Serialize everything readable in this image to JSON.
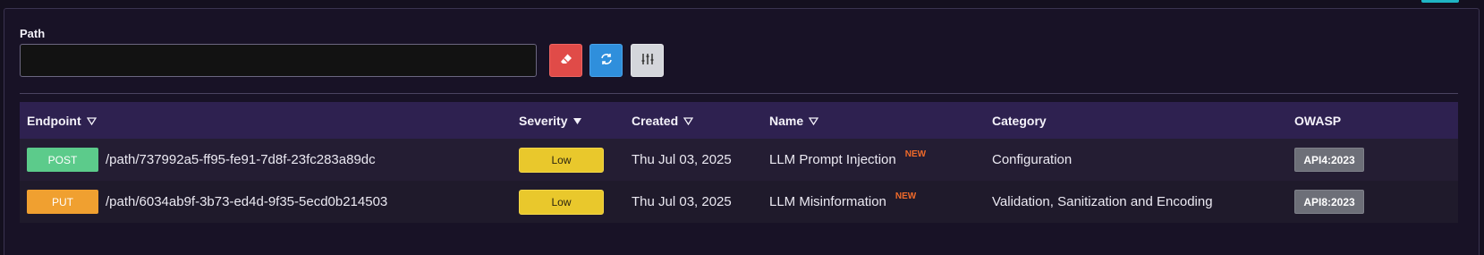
{
  "filter": {
    "path_label": "Path",
    "path_value": "",
    "path_placeholder": "",
    "buttons": [
      {
        "name": "clear",
        "icon": "eraser-icon"
      },
      {
        "name": "refresh",
        "icon": "refresh-icon"
      },
      {
        "name": "filters",
        "icon": "sliders-icon"
      }
    ]
  },
  "table": {
    "columns": [
      "Endpoint",
      "Severity",
      "Created",
      "Name",
      "Category",
      "OWASP"
    ],
    "rows": [
      {
        "method": "POST",
        "path": "/path/737992a5-ff95-fe91-7d8f-23fc283a89dc",
        "severity": "Low",
        "created": "Thu Jul 03, 2025",
        "name": "LLM Prompt Injection",
        "badge": "NEW",
        "category": "Configuration",
        "owasp": "API4:2023"
      },
      {
        "method": "PUT",
        "path": "/path/6034ab9f-3b73-ed4d-9f35-5ecd0b214503",
        "severity": "Low",
        "created": "Thu Jul 03, 2025",
        "name": "LLM Misinformation",
        "badge": "NEW",
        "category": "Validation, Sanitization and Encoding",
        "owasp": "API8:2023"
      }
    ]
  },
  "colors": {
    "post": "#5ccb8b",
    "put": "#f0a030",
    "severity_low": "#e9c82c",
    "new_badge": "#f06a2a",
    "header_bg": "#2e2150"
  }
}
